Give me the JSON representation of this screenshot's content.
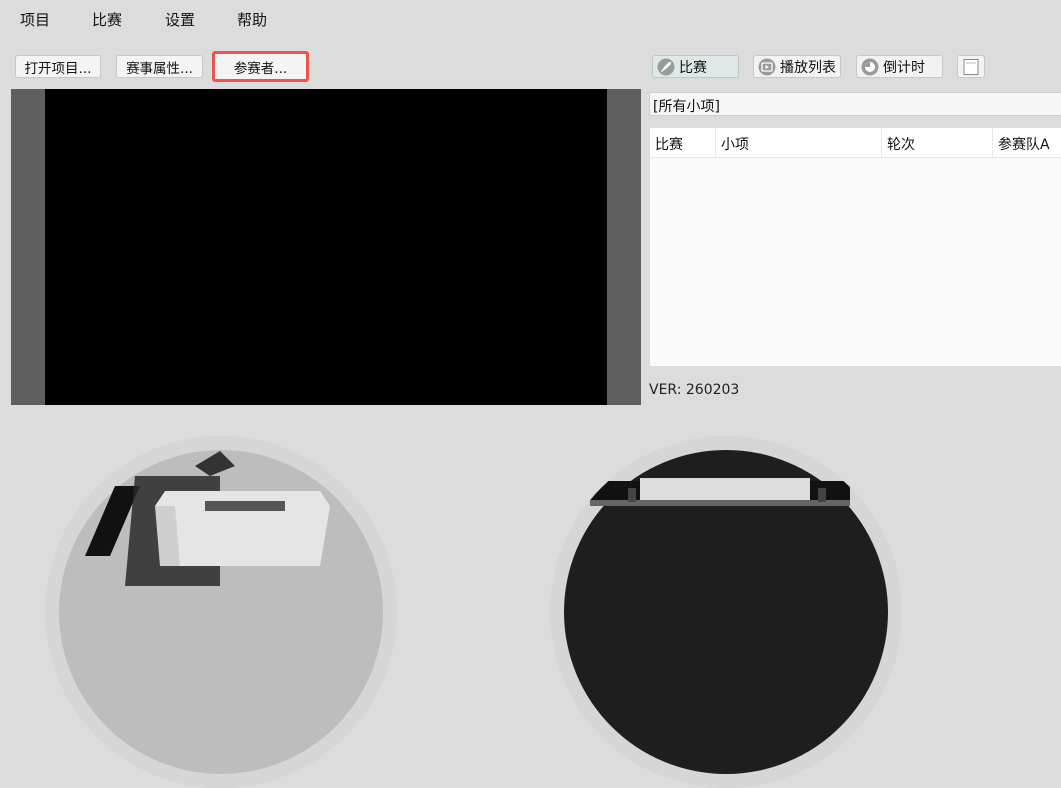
{
  "menu": [
    "项目",
    "比赛",
    "设置",
    "帮助"
  ],
  "toolbar": {
    "open_project": "打开项目...",
    "event_properties": "赛事属性...",
    "participants": "参赛者..."
  },
  "right_toolbar": {
    "match": "比赛",
    "playlist": "播放列表",
    "countdown": "倒计时"
  },
  "filter": {
    "value": "[所有小项]"
  },
  "table": {
    "columns": [
      "比赛",
      "小项",
      "轮次",
      "参赛队A"
    ]
  },
  "version": "VER: 260203"
}
